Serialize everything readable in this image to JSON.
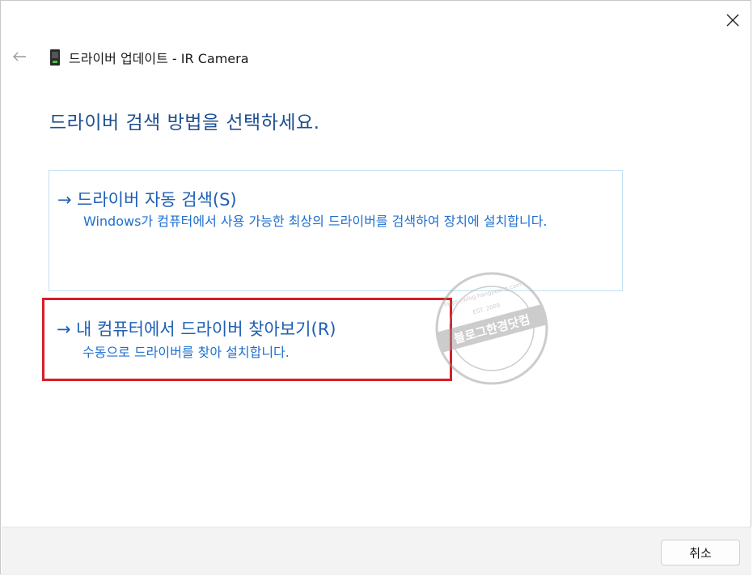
{
  "window": {
    "title": "드라이버 업데이트 - IR Camera",
    "device_icon": "camera-device-icon"
  },
  "heading": "드라이버 검색 방법을 선택하세요.",
  "options": [
    {
      "arrow": "→",
      "title": "드라이버 자동 검색(S)",
      "description": "Windows가 컴퓨터에서 사용 가능한 최상의 드라이버를 검색하여 장치에 설치합니다."
    },
    {
      "arrow": "→",
      "title": "내 컴퓨터에서 드라이버 찾아보기(R)",
      "description": "수동으로 드라이버를 찾아 설치합니다."
    }
  ],
  "watermark": {
    "text": "블로그한경닷컴",
    "url": "https://blog.hangyeong.com",
    "est": "EST. 2009"
  },
  "footer": {
    "cancel_label": "취소"
  },
  "colors": {
    "heading": "#1e4f91",
    "link": "#1d5fb4",
    "highlight": "#d61f26",
    "option_border": "#bfe0f5"
  }
}
